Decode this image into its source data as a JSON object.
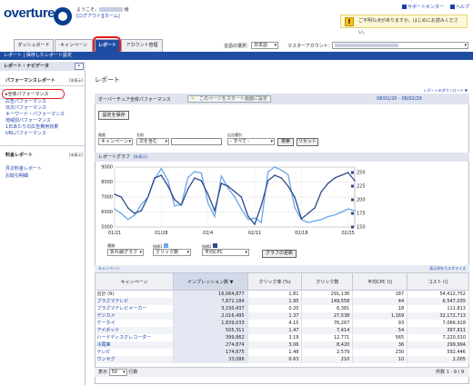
{
  "header": {
    "logo_text": "overture",
    "welcome_prefix": "ようこそ、",
    "welcome_suffix": " 様",
    "logout_label": "[ログアウト]",
    "home_label": "[ホーム]",
    "support_link": "サポートセンター",
    "help_link": "ヘルプ",
    "notice_text": "ご不明な点がありますか。はじめにお読みください。"
  },
  "tabs": [
    {
      "label": "ダッシュボード",
      "active": false
    },
    {
      "label": "キャンペーン",
      "active": false
    },
    {
      "label": "レポート",
      "active": true
    },
    {
      "label": "アカウント管理",
      "active": false
    }
  ],
  "language": {
    "label": "言語の選択：",
    "value": "日本語"
  },
  "master_account": {
    "label": "マスターアカウント："
  },
  "subnav": {
    "item1": "レポート",
    "sep": "|",
    "item2": "保存したレポート設定"
  },
  "sidebar": {
    "title": "レポート・ナビゲータ",
    "collapse_icon": "«",
    "section1": "パフォーマンスレポート",
    "section1_hide": "[非表示]",
    "perf_links": [
      "全体パフォーマンス",
      "広告パフォーマンス",
      "日次パフォーマンス",
      "キーワード・パフォーマンス",
      "地域別パフォーマンス",
      "1日あたりの広告費用効果",
      "URLパフォーマンス"
    ],
    "section2": "料金レポート",
    "section2_hide": "[非表示]",
    "billing_links": [
      "月次料金レポート",
      "お取引明細"
    ]
  },
  "main": {
    "title": "レポート",
    "download_link": "レポートのダウンロード ▼",
    "panel_title": "オーバーチュア全体パフォーマンス",
    "startpage_btn": "このページをスタート画面に設定",
    "date_range": "08/01/20 - 08/02/26",
    "save_btn": "設定を保存",
    "filters": {
      "level_label": "階層",
      "level_value": "キャンペーン",
      "name_label": "名前",
      "name_value": "次を含む",
      "type_label": "広告種別",
      "type_value": "- すべて -",
      "search_btn": "検索",
      "reset_btn": "リセット"
    },
    "graph_title": "レポートグラフ",
    "graph_hide": "[非表示]",
    "graph_controls": {
      "type_label": "種類",
      "type_value": "折れ線グラフ",
      "m1_label": "指標1",
      "m1_value": "クリック数",
      "m2_label": "指標2",
      "m2_value": "平均CPC",
      "update_btn": "グラフの更新"
    },
    "table_caption": "キャンペーン",
    "customize_link": "表示列をカスタマイズ",
    "columns": [
      "キャンペーン",
      "インプレッション数 ▼",
      "クリック率 (%)",
      "クリック数",
      "平均CPC (\\)",
      "コスト (\\)"
    ],
    "rows": [
      [
        "合計 (9)",
        "16,064,877",
        "1.81",
        "291,136",
        "187",
        "54,412,752"
      ],
      [
        "ブラズマテレビ",
        "7,872,184",
        "1.95",
        "149,558",
        "44",
        "6,547,035"
      ],
      [
        "ブラズマテレビメーカー",
        "3,150,437",
        "0.20",
        "6,381",
        "18",
        "111,813"
      ],
      [
        "デジカメ",
        "2,016,495",
        "1.37",
        "27,538",
        "1,169",
        "32,172,713"
      ],
      [
        "ケータイ",
        "1,839,033",
        "4.15",
        "76,267",
        "93",
        "7,066,928"
      ],
      [
        "アイポッド",
        "505,311",
        "1.47",
        "7,414",
        "54",
        "397,811"
      ],
      [
        "ハードディスクレコーダー",
        "399,862",
        "3.19",
        "12,771",
        "565",
        "7,220,010"
      ],
      [
        "冷蔵庫",
        "274,874",
        "3.06",
        "8,420",
        "36",
        "299,994"
      ],
      [
        "テレビ",
        "174,675",
        "1.48",
        "2,579",
        "230",
        "592,446"
      ],
      [
        "ワンセグ",
        "33,086",
        "0.63",
        "210",
        "10",
        "2,005"
      ]
    ],
    "footer": {
      "show_label": "表示",
      "show_value": "50",
      "rows_label": "行数",
      "page_info": "件数 1 - 9 / 9"
    }
  },
  "colors": {
    "nav_blue": "#1f4da3",
    "series1": "#2e4a8a",
    "series2": "#6aa6e8",
    "highlight": "#e21b1b"
  },
  "chart_data": {
    "type": "line",
    "x": [
      "1/21",
      "1/22",
      "1/23",
      "1/24",
      "1/25",
      "1/26",
      "1/27",
      "1/28",
      "1/29",
      "1/30",
      "1/31",
      "2/1",
      "2/2",
      "2/3",
      "2/4",
      "2/5",
      "2/6",
      "2/7",
      "2/8",
      "2/9",
      "2/10",
      "2/11",
      "2/12",
      "2/13",
      "2/14",
      "2/15",
      "2/16",
      "2/17",
      "2/18",
      "2/19",
      "2/20",
      "2/21",
      "2/22",
      "2/23",
      "2/24",
      "2/25",
      "2/26"
    ],
    "x_tick_labels": [
      "01/21",
      "01/28",
      "02/4",
      "02/11",
      "02/18",
      "02/25"
    ],
    "series": [
      {
        "values": [
          6200,
          5900,
          5500,
          5800,
          6500,
          7000,
          8200,
          8900,
          8100,
          6400,
          6500,
          8300,
          8700,
          8600,
          6600,
          5700,
          8400,
          7600,
          7000,
          6200,
          5500,
          5600,
          5300,
          8700,
          9000,
          8800,
          8500,
          6300,
          5500,
          5300,
          5400,
          5500,
          5700,
          5800,
          6000,
          6200,
          6100
        ]
      },
      {
        "values": [
          210,
          205,
          185,
          175,
          180,
          205,
          240,
          245,
          225,
          200,
          190,
          220,
          240,
          235,
          210,
          180,
          230,
          225,
          215,
          205,
          170,
          155,
          190,
          235,
          245,
          240,
          225,
          205,
          165,
          175,
          185,
          215,
          230,
          240,
          245,
          250,
          235
        ]
      }
    ],
    "y_left": {
      "ticks": [
        5000,
        6000,
        7000,
        8000,
        9000
      ],
      "range": [
        5000,
        9000
      ]
    },
    "y_right": {
      "ticks": [
        150,
        175,
        200,
        225,
        250
      ],
      "range": [
        150,
        260
      ]
    },
    "grid": true
  }
}
